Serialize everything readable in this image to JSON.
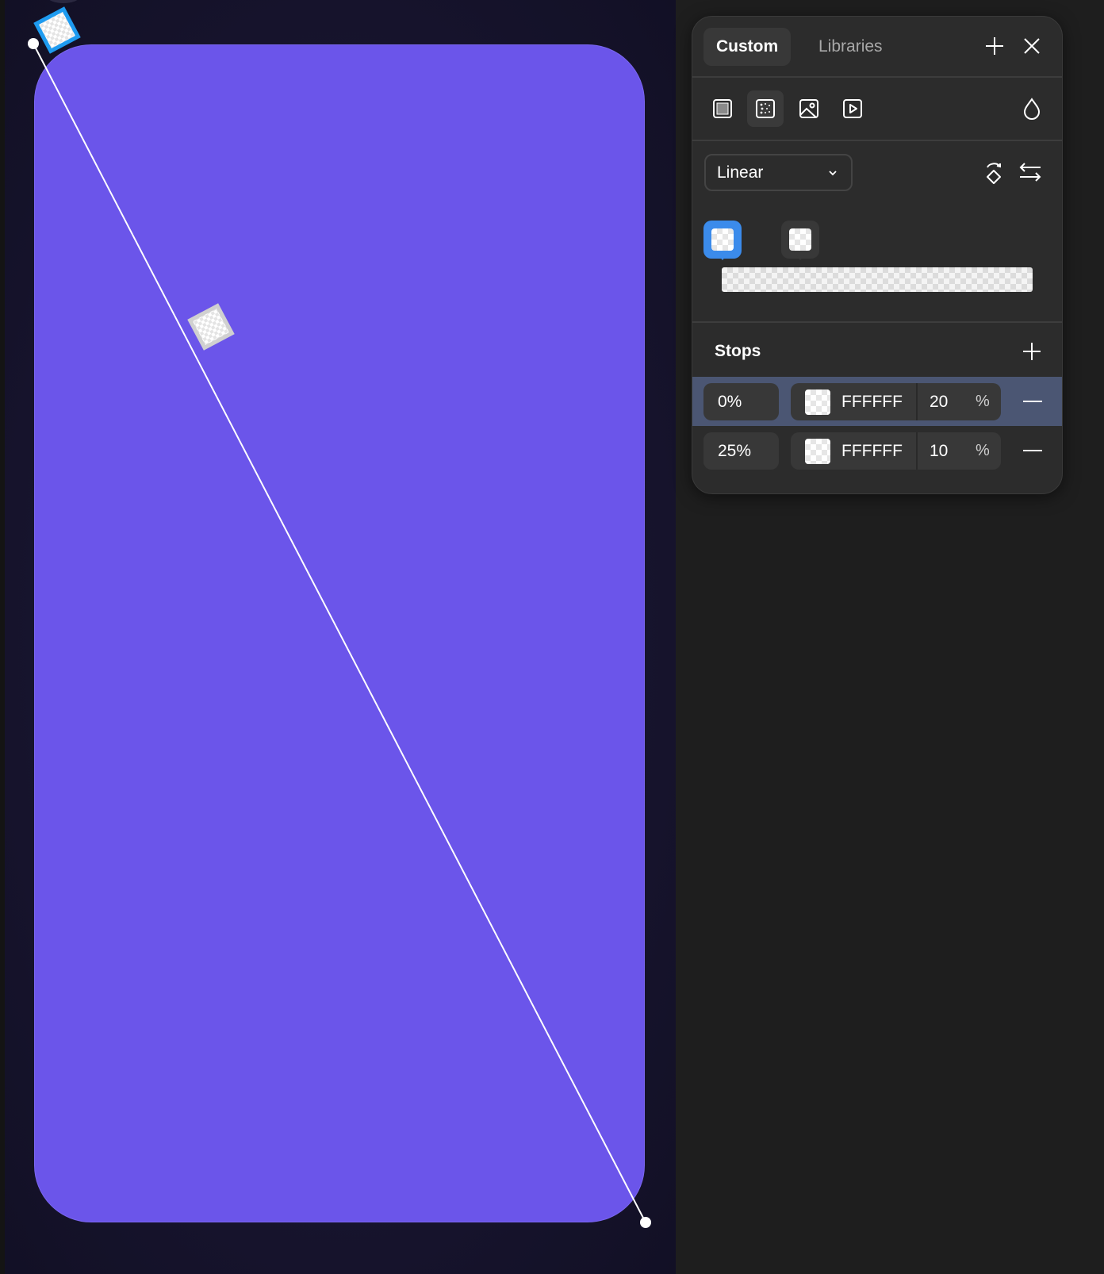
{
  "canvas": {
    "shape_fill": "#6B55EA",
    "handle_color_active": "#1E9BF0"
  },
  "panel": {
    "tabs": [
      {
        "label": "Custom",
        "active": true
      },
      {
        "label": "Libraries",
        "active": false
      }
    ],
    "header_icons": [
      "plus-icon",
      "close-icon"
    ],
    "fill_types": [
      {
        "name": "solid-fill-icon",
        "selected": false
      },
      {
        "name": "gradient-fill-icon",
        "selected": true
      },
      {
        "name": "image-fill-icon",
        "selected": false
      },
      {
        "name": "video-fill-icon",
        "selected": false
      }
    ],
    "eyedropper_icon": "opacity-drop-icon",
    "gradient_type": "Linear",
    "gradient_actions": [
      "rotate-gradient-icon",
      "flip-gradient-icon"
    ],
    "stops_title": "Stops",
    "stops": [
      {
        "position": "0%",
        "hex": "FFFFFF",
        "opacity": "20",
        "opacity_unit": "%",
        "selected": true
      },
      {
        "position": "25%",
        "hex": "FFFFFF",
        "opacity": "10",
        "opacity_unit": "%",
        "selected": false
      }
    ],
    "accent_color": "#3B8BEB",
    "selected_row_color": "#4B5673"
  }
}
